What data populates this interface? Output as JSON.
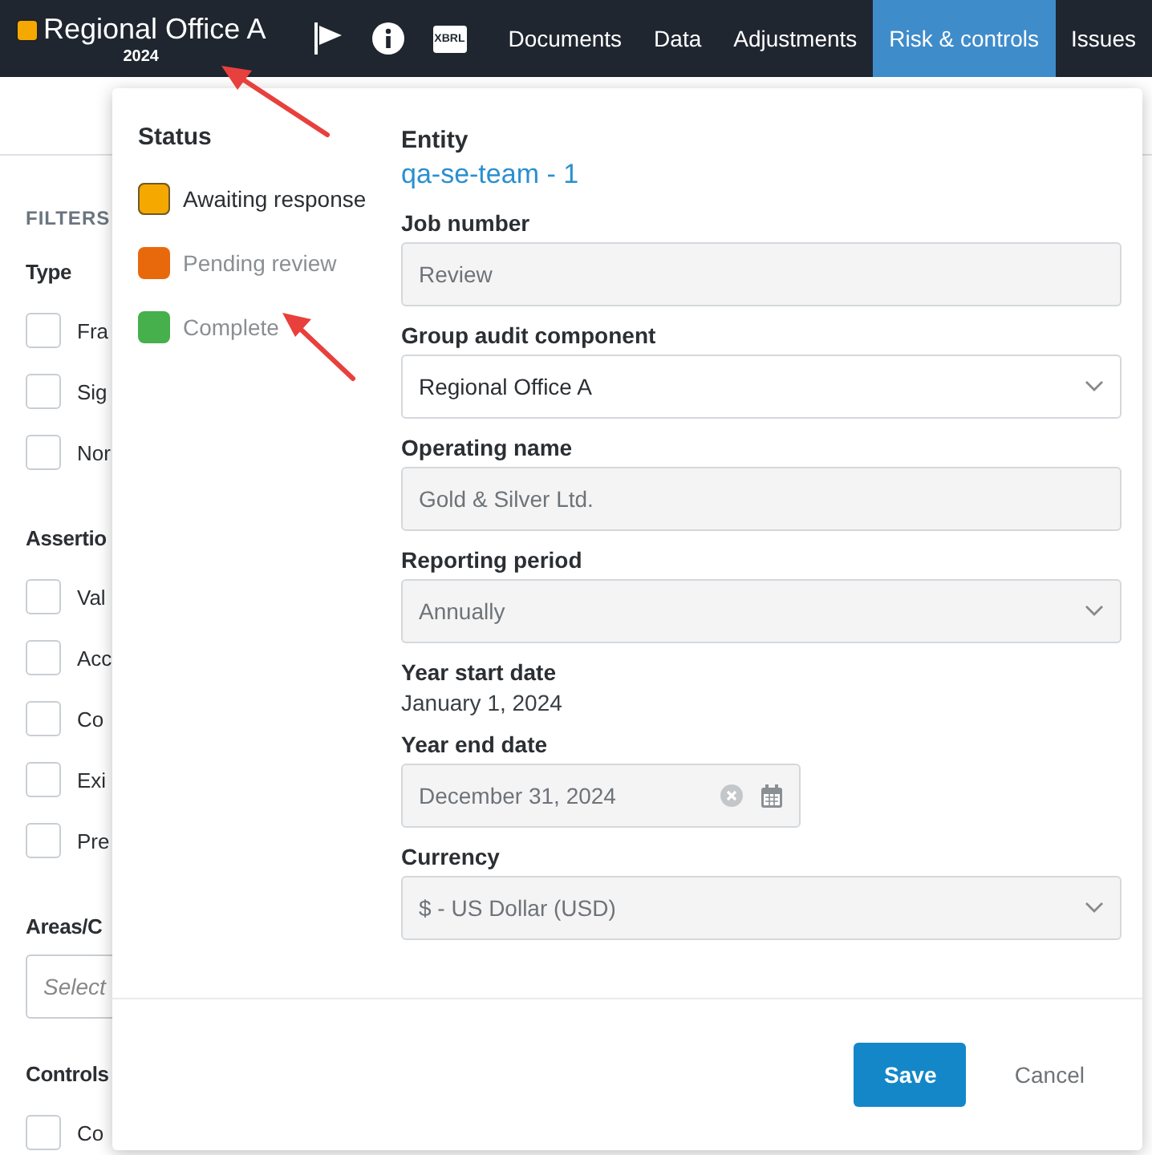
{
  "header": {
    "title": "Regional Office A",
    "year": "2024",
    "xbrl": "XBRL",
    "nav": [
      {
        "label": "Documents",
        "selected": false
      },
      {
        "label": "Data",
        "selected": false
      },
      {
        "label": "Adjustments",
        "selected": false
      },
      {
        "label": "Risk & controls",
        "selected": true
      },
      {
        "label": "Issues",
        "selected": false
      }
    ]
  },
  "filters": {
    "heading": "FILTERS",
    "groups": [
      {
        "title": "Type",
        "kind": "checkboxes",
        "options": [
          {
            "label": "Fra",
            "checked": false
          },
          {
            "label": "Sig",
            "checked": false
          },
          {
            "label": "Nor",
            "checked": false
          }
        ]
      },
      {
        "title": "Assertio",
        "kind": "checkboxes",
        "options": [
          {
            "label": "Val",
            "checked": false
          },
          {
            "label": "Acc",
            "checked": false
          },
          {
            "label": "Co",
            "checked": false
          },
          {
            "label": "Exi",
            "checked": false
          },
          {
            "label": "Pre",
            "checked": false
          }
        ]
      },
      {
        "title": "Areas/C",
        "kind": "select",
        "placeholder": "Select"
      },
      {
        "title": "Controls",
        "kind": "checkboxes",
        "options": [
          {
            "label": "Co",
            "checked": false
          }
        ]
      }
    ]
  },
  "status_panel": {
    "title": "Status",
    "items": [
      {
        "label": "Awaiting response",
        "color": "#f5a800",
        "selected": true
      },
      {
        "label": "Pending review",
        "color": "#e8690c",
        "selected": false
      },
      {
        "label": "Complete",
        "color": "#45b04c",
        "selected": false
      }
    ]
  },
  "form": {
    "entity_label": "Entity",
    "entity": "qa-se-team - 1",
    "fields": [
      {
        "label": "Job number",
        "kind": "text",
        "value": "Review",
        "disabled": true
      },
      {
        "label": "Group audit component",
        "kind": "select",
        "value": "Regional Office A",
        "disabled": false
      },
      {
        "label": "Operating name",
        "kind": "text",
        "value": "Gold & Silver Ltd.",
        "disabled": true
      },
      {
        "label": "Reporting period",
        "kind": "select",
        "value": "Annually",
        "disabled": true
      },
      {
        "label": "Year start date",
        "kind": "static",
        "value": "January 1, 2024"
      },
      {
        "label": "Year end date",
        "kind": "date",
        "value": "December 31, 2024",
        "disabled": true
      },
      {
        "label": "Currency",
        "kind": "select",
        "value": "$ - US Dollar (USD)",
        "disabled": true
      }
    ]
  },
  "actions": {
    "save": "Save",
    "cancel": "Cancel"
  }
}
